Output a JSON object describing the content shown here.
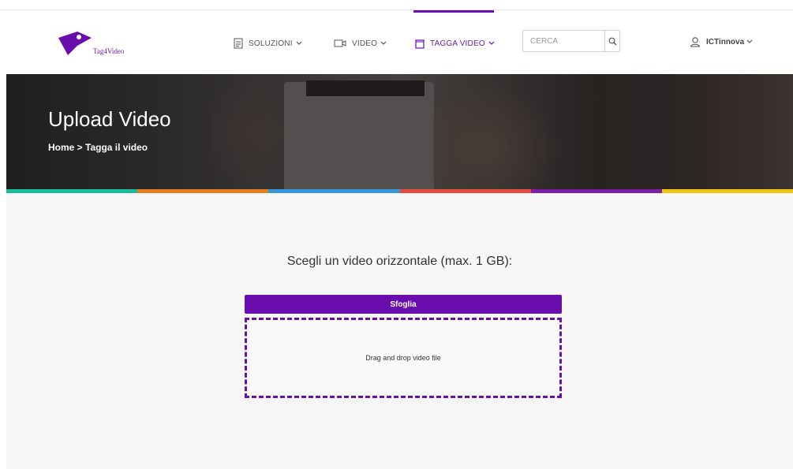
{
  "brand": {
    "name": "Tag4Video",
    "color": "#6a0dad"
  },
  "nav": {
    "items": [
      {
        "label": "SOLUZIONI",
        "icon": "document-icon"
      },
      {
        "label": "VIDEO",
        "icon": "video-camera-icon"
      },
      {
        "label": "TAGGA VIDEO",
        "icon": "clipboard-icon",
        "active": true
      }
    ]
  },
  "search": {
    "placeholder": "CERCA",
    "icon": "search-icon"
  },
  "user": {
    "name": "ICTinnova",
    "icon": "user-icon"
  },
  "hero": {
    "title": "Upload Video",
    "breadcrumb": "Home > Tagga il video"
  },
  "colorbar": [
    "#1abc9c",
    "#e67e22",
    "#3498db",
    "#e74c3c",
    "#7b1fa2",
    "#f1c40f"
  ],
  "upload": {
    "prompt": "Scegli un video orizzontale (max. 1 GB):",
    "browse_label": "Sfoglia",
    "dropzone_text": "Drag and drop video file"
  }
}
